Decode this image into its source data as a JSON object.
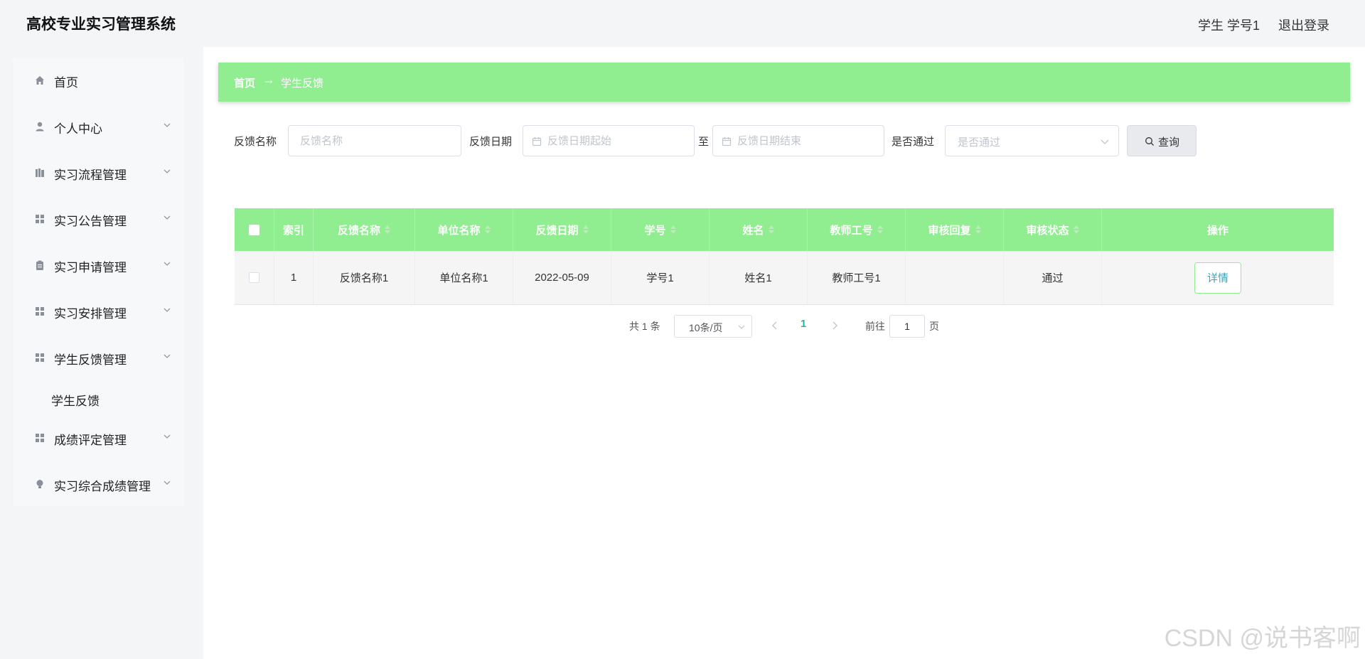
{
  "header": {
    "title": "高校专业实习管理系统",
    "user": "学生 学号1",
    "logout": "退出登录"
  },
  "sidebar": {
    "items": [
      {
        "label": "首页",
        "icon": "home-icon",
        "chevron": false
      },
      {
        "label": "个人中心",
        "icon": "user-icon",
        "chevron": true
      },
      {
        "label": "实习流程管理",
        "icon": "books-icon",
        "chevron": true
      },
      {
        "label": "实习公告管理",
        "icon": "grid-icon",
        "chevron": true
      },
      {
        "label": "实习申请管理",
        "icon": "clipboard-icon",
        "chevron": true
      },
      {
        "label": "实习安排管理",
        "icon": "grid-icon",
        "chevron": true
      },
      {
        "label": "学生反馈管理",
        "icon": "grid-icon",
        "chevron": true
      },
      {
        "label": "成绩评定管理",
        "icon": "grid-icon",
        "chevron": true
      },
      {
        "label": "实习综合成绩管理",
        "icon": "bulb-icon",
        "chevron": true
      }
    ],
    "subitem": "学生反馈"
  },
  "breadcrumb": {
    "home": "首页",
    "arrow": "→",
    "current": "学生反馈"
  },
  "filters": {
    "name_label": "反馈名称",
    "name_placeholder": "反馈名称",
    "date_label": "反馈日期",
    "date_start_placeholder": "反馈日期起始",
    "to_label": "至",
    "date_end_placeholder": "反馈日期结束",
    "pass_label": "是否通过",
    "pass_placeholder": "是否通过",
    "query_label": "查询"
  },
  "table": {
    "columns": [
      "索引",
      "反馈名称",
      "单位名称",
      "反馈日期",
      "学号",
      "姓名",
      "教师工号",
      "审核回复",
      "审核状态",
      "操作"
    ],
    "rows": [
      {
        "index": "1",
        "name": "反馈名称1",
        "unit": "单位名称1",
        "date": "2022-05-09",
        "student_no": "学号1",
        "student_name": "姓名1",
        "teacher_no": "教师工号1",
        "reply": "",
        "status": "通过",
        "action": "详情"
      }
    ]
  },
  "pagination": {
    "total": "共 1 条",
    "page_size": "10条/页",
    "current_page": "1",
    "goto_label": "前往",
    "goto_value": "1",
    "goto_unit": "页"
  },
  "watermark": "CSDN @说书客啊",
  "colors": {
    "accent": "#90ee90",
    "page_active": "#2bb3a2",
    "detail_text": "#3fa3b8"
  }
}
